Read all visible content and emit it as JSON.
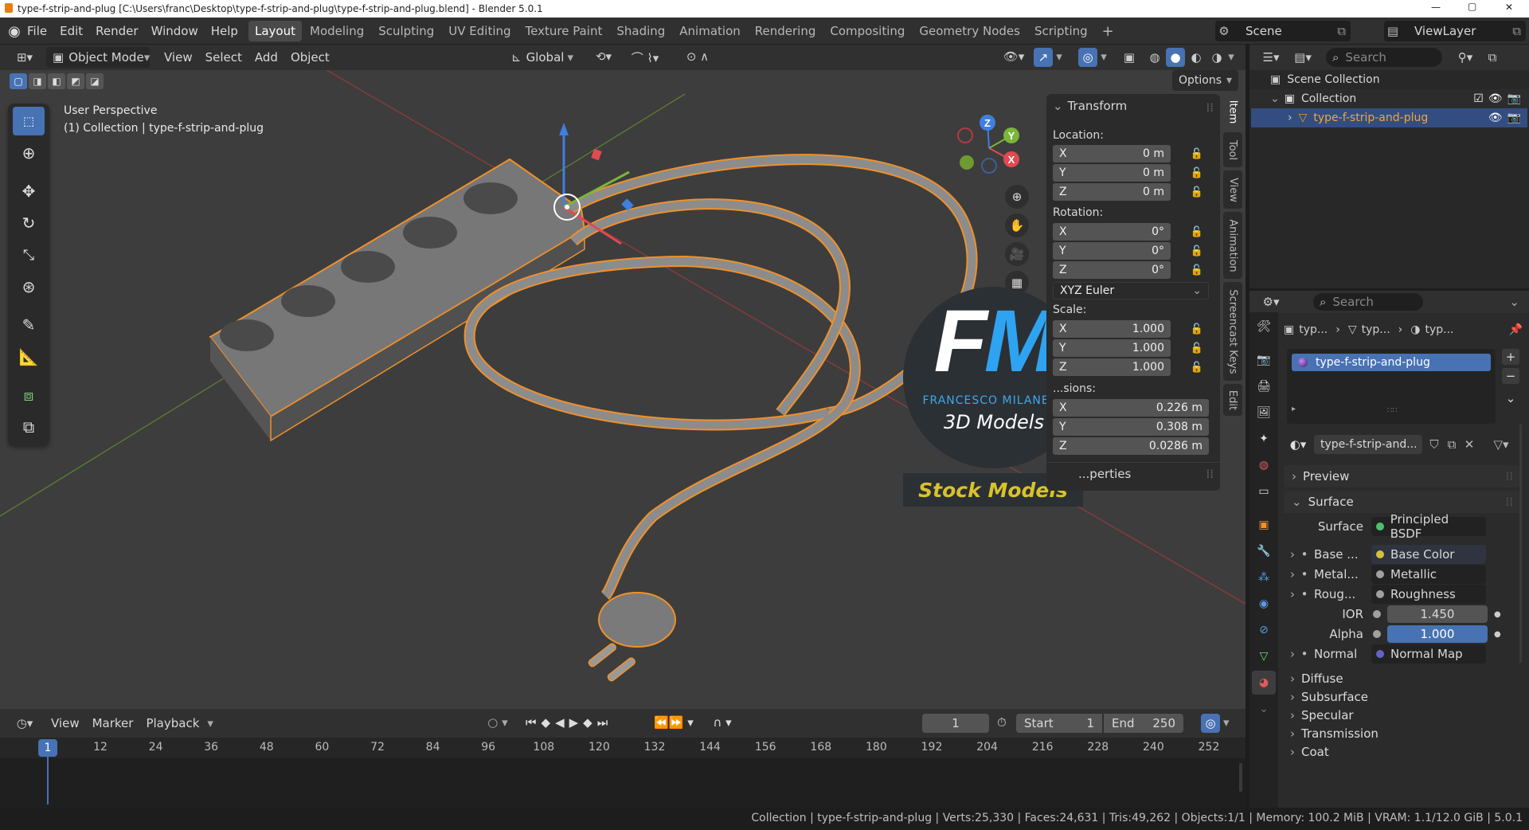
{
  "window": {
    "title": "type-f-strip-and-plug [C:\\Users\\franc\\Desktop\\type-f-strip-and-plug\\type-f-strip-and-plug.blend] - Blender 5.0.1",
    "minimize": "—",
    "maximize": "▢",
    "close": "✕"
  },
  "menus": [
    "File",
    "Edit",
    "Render",
    "Window",
    "Help"
  ],
  "workspaces": [
    "Layout",
    "Modeling",
    "Sculpting",
    "UV Editing",
    "Texture Paint",
    "Shading",
    "Animation",
    "Rendering",
    "Compositing",
    "Geometry Nodes",
    "Scripting"
  ],
  "active_workspace": "Layout",
  "scene": "Scene",
  "view_layer": "ViewLayer",
  "viewport_header": {
    "mode": "Object Mode",
    "menus": [
      "View",
      "Select",
      "Add",
      "Object"
    ],
    "transform_orientation": "Global",
    "options": "Options"
  },
  "viewport": {
    "perspective": "User Perspective",
    "collection_info": "(1) Collection | type-f-strip-and-plug",
    "gizmo_axes": {
      "x": "X",
      "y": "Y",
      "z": "Z"
    }
  },
  "watermark": {
    "logo": "FM",
    "author": "FRANCESCO MILANESE",
    "subtitle": "3D Models",
    "banner": "Stock Models"
  },
  "npanel": {
    "header": "Transform",
    "location_label": "Location:",
    "location": [
      {
        "axis": "X",
        "value": "0 m"
      },
      {
        "axis": "Y",
        "value": "0 m"
      },
      {
        "axis": "Z",
        "value": "0 m"
      }
    ],
    "rotation_label": "Rotation:",
    "rotation": [
      {
        "axis": "X",
        "value": "0°"
      },
      {
        "axis": "Y",
        "value": "0°"
      },
      {
        "axis": "Z",
        "value": "0°"
      }
    ],
    "rotation_mode": "XYZ Euler",
    "scale_label": "Scale:",
    "scale": [
      {
        "axis": "X",
        "value": "1.000"
      },
      {
        "axis": "Y",
        "value": "1.000"
      },
      {
        "axis": "Z",
        "value": "1.000"
      }
    ],
    "dimensions_label": "...sions:",
    "dimensions": [
      {
        "axis": "X",
        "value": "0.226 m"
      },
      {
        "axis": "Y",
        "value": "0.308 m"
      },
      {
        "axis": "Z",
        "value": "0.0286 m"
      }
    ],
    "properties_label": "...perties",
    "tabs": [
      "Item",
      "Tool",
      "View",
      "Animation",
      "Screencast Keys",
      "Edit"
    ]
  },
  "outliner": {
    "search_placeholder": "Search",
    "scene_collection": "Scene Collection",
    "collection": "Collection",
    "object": "type-f-strip-and-plug"
  },
  "properties": {
    "search_placeholder": "Search",
    "breadcrumb": [
      "typ...",
      "typ...",
      "typ..."
    ],
    "material_slot": "type-f-strip-and-plug",
    "material_name": "type-f-strip-and...",
    "sections": {
      "preview": "Preview",
      "surface": "Surface"
    },
    "surface_shader_label": "Surface",
    "surface_shader": "Principled BSDF",
    "inputs": [
      {
        "label": "Base ...",
        "value": "Base Color",
        "color": "#d4c23a"
      },
      {
        "label": "Metal...",
        "value": "Metallic",
        "color": "#a0a0a0"
      },
      {
        "label": "Roug...",
        "value": "Roughness",
        "color": "#a0a0a0"
      }
    ],
    "ior_label": "IOR",
    "ior": "1.450",
    "alpha_label": "Alpha",
    "alpha": "1.000",
    "normal_label": "Normal",
    "normal_value": "Normal Map",
    "subsections": [
      "Diffuse",
      "Subsurface",
      "Specular",
      "Transmission",
      "Coat"
    ]
  },
  "timeline": {
    "menus": [
      "View",
      "Marker",
      "Playback"
    ],
    "current_frame": "1",
    "start_label": "Start",
    "start": "1",
    "end_label": "End",
    "end": "250",
    "frame_marker": "1",
    "ticks": [
      "12",
      "24",
      "36",
      "48",
      "60",
      "72",
      "84",
      "96",
      "108",
      "120",
      "132",
      "144",
      "156",
      "168",
      "180",
      "192",
      "204",
      "216",
      "228",
      "240",
      "252"
    ]
  },
  "status": "Collection | type-f-strip-and-plug | Verts:25,330 | Faces:24,631 | Tris:49,262 | Objects:1/1 | Memory: 100.2 MiB | VRAM: 1.1/12.0 GiB | 5.0.1",
  "colors": {
    "accent": "#4772b3",
    "selection": "#f0902a",
    "axis_x": "#e04a52",
    "axis_y": "#7bb53a",
    "axis_z": "#3f7fe0"
  }
}
